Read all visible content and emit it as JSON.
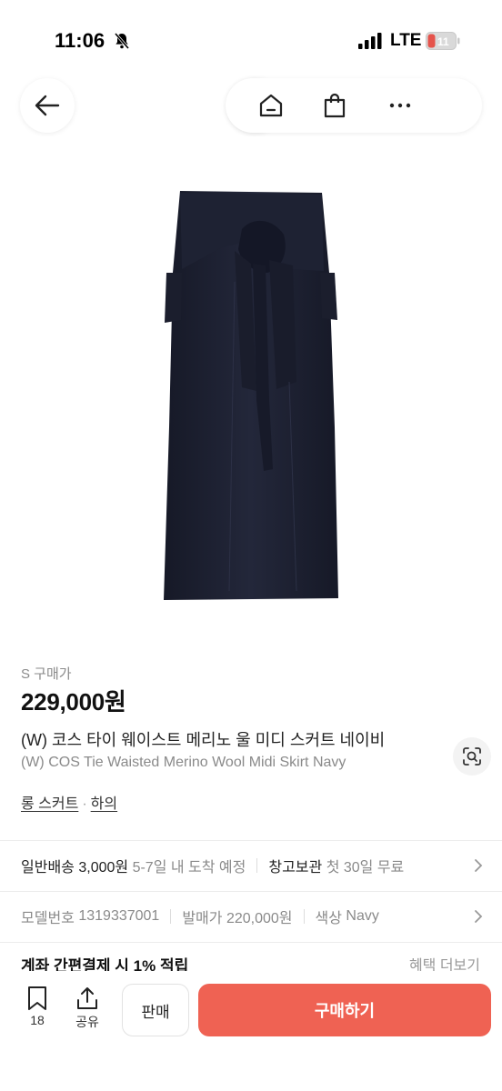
{
  "status_bar": {
    "time": "11:06",
    "network": "LTE",
    "battery": "11"
  },
  "nav": {
    "icons": [
      "back-arrow-icon",
      "search-icon",
      "home-icon",
      "shopping-bag-icon",
      "more-icon"
    ]
  },
  "product": {
    "size_label": "S 구매가",
    "price": "229,000원",
    "title_ko": "(W) 코스 타이 웨이스트 메리노 울 미디 스커트 네이비",
    "title_en": "(W) COS Tie Waisted Merino Wool Midi Skirt Navy",
    "category_1": "롱 스커트",
    "category_sep": "·",
    "category_2": "하의"
  },
  "shipping": {
    "label": "일반배송",
    "fee": "3,000원",
    "eta": "5-7일 내 도착 예정",
    "storage_label": "창고보관",
    "storage_note": "첫 30일 무료"
  },
  "details": {
    "model_label": "모델번호",
    "model_no": "1319337001",
    "release_label": "발매가",
    "release_price": "220,000원",
    "color_label": "색상",
    "color": "Navy"
  },
  "payment": {
    "promo": "계좌 간편결제 시 1% 적립",
    "more": "혜택 더보기"
  },
  "bottom": {
    "bookmark_count": "18",
    "share_label": "공유",
    "sell_label": "판매",
    "buy_label": "구매하기"
  },
  "colors": {
    "accent": "#ef6253",
    "skirt": "#1c1f2e"
  }
}
